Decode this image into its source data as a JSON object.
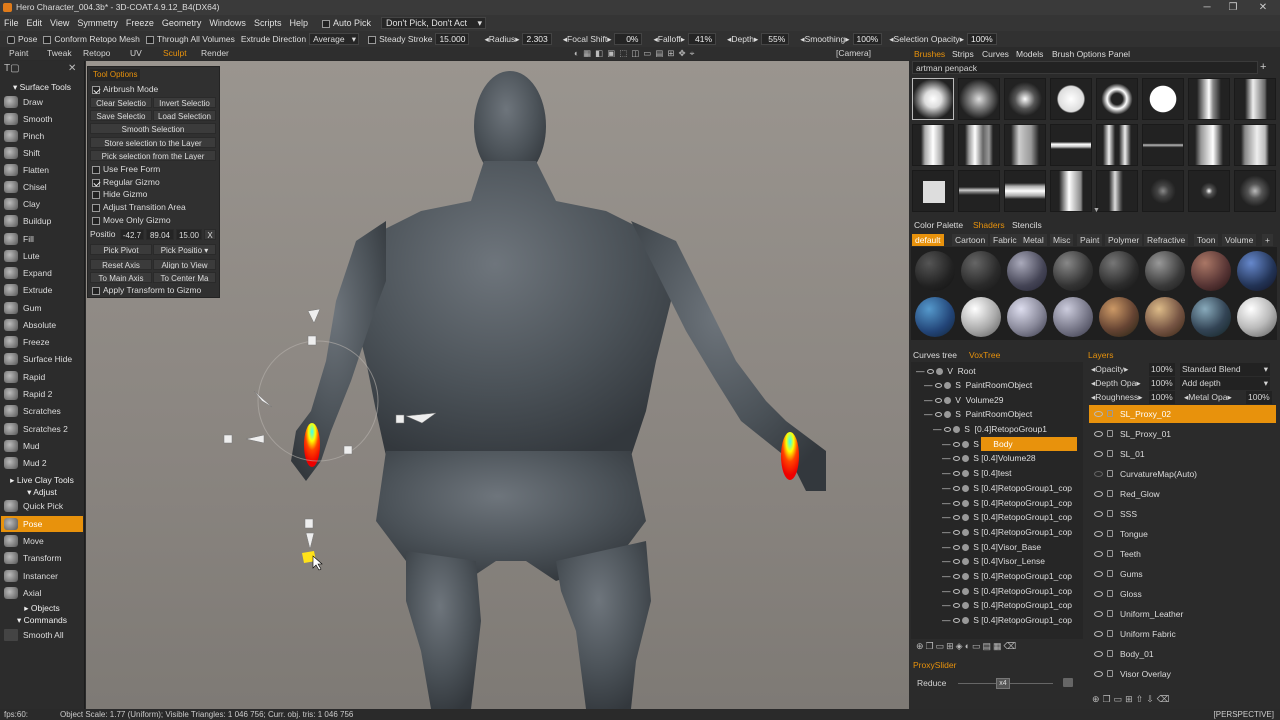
{
  "window": {
    "title": "Hero Character_004.3b* - 3D-COAT.4.9.12_B4(DX64)",
    "minimize": "─",
    "maximize": "❐",
    "close": "✕"
  },
  "menu": [
    "File",
    "Edit",
    "View",
    "Symmetry",
    "Freeze",
    "Geometry",
    "Windows",
    "Scripts",
    "Help"
  ],
  "menu_extra": {
    "auto_pick": "Auto Pick",
    "pick_mode": "Don't Pick, Don't Act"
  },
  "toolbar1": {
    "pose": "Pose",
    "conform": "Conform Retopo Mesh",
    "through": "Through All Volumes",
    "extrude_dir": "Extrude Direction",
    "extrude_val": "Average",
    "steady": "Steady Stroke",
    "steady_val": "15.000",
    "radius": "Radius",
    "radius_val": "2.303",
    "focal": "Focal Shift",
    "focal_val": "0%",
    "falloff": "Falloff",
    "falloff_val": "41%",
    "depth": "Depth",
    "depth_val": "55%",
    "smoothing": "Smoothing",
    "smoothing_val": "100%",
    "sel_opacity": "Selection Opacity",
    "sel_opacity_val": "100%"
  },
  "tabs": [
    "Paint",
    "Tweak",
    "Retopo",
    "UV",
    "Sculpt",
    "Render"
  ],
  "camera": "[Camera]",
  "left_panel": {
    "surface_tools": "Surface Tools",
    "surface": [
      "Draw",
      "Smooth",
      "Pinch",
      "Shift",
      "Flatten",
      "Chisel",
      "Clay",
      "Buildup",
      "Fill",
      "Lute",
      "Expand",
      "Extrude",
      "Gum",
      "Absolute",
      "Freeze",
      "Surface Hide",
      "Rapid",
      "Rapid 2",
      "Scratches",
      "Scratches 2",
      "Mud",
      "Mud 2"
    ],
    "live_clay": "Live Clay Tools",
    "adjust": "Adjust",
    "adjust_tools": [
      "Quick Pick",
      "Pose",
      "Move",
      "Transform",
      "Instancer",
      "Axial"
    ],
    "objects": "Objects",
    "commands": "Commands",
    "smooth_all": "Smooth All"
  },
  "tool_options": {
    "tab": "Tool Options",
    "airbrush": "Airbrush Mode",
    "clear": "Clear Selectio",
    "invert": "Invert Selectio",
    "save": "Save Selectio",
    "load": "Load Selection",
    "smooth_sel": "Smooth Selection",
    "store": "Store selection to the Layer",
    "pick_layer": "Pick selection from the Layer",
    "free_form": "Use Free Form",
    "regular_gizmo": "Regular Gizmo",
    "hide_gizmo": "Hide Gizmo",
    "adjust_transition": "Adjust Transition Area",
    "move_only": "Move Only Gizmo",
    "position_label": "Positio",
    "pos_x": "-42.7",
    "pos_y": "89.04",
    "pos_z": "15.00",
    "pos_clear": "X",
    "pick_pivot": "Pick Pivot",
    "pick_position": "Pick Positio",
    "reset_axis": "Reset Axis",
    "align_view": "Align to View",
    "to_main_axis": "To Main Axis",
    "to_center": "To Center Ma",
    "apply_transform": "Apply Transform to Gizmo"
  },
  "brushes": {
    "tab": "Brushes",
    "others": [
      "Strips",
      "Curves",
      "Models",
      "Brush Options Panel"
    ],
    "pack": "artman penpack"
  },
  "shaders": {
    "tabs": [
      "Color Palette",
      "Shaders",
      "Stencils"
    ],
    "categories": [
      "default",
      "Cartoon",
      "Fabric",
      "Metal",
      "Misc",
      "Paint",
      "Polymer",
      "Refractive",
      "Toon",
      "Volume"
    ]
  },
  "vox_tree": {
    "tabs": [
      "Curves tree",
      "VoxTree"
    ],
    "items": [
      {
        "indent": 0,
        "type": "V",
        "name": "Root"
      },
      {
        "indent": 1,
        "type": "S",
        "name": "PaintRoomObject"
      },
      {
        "indent": 1,
        "type": "V",
        "name": "Volume29"
      },
      {
        "indent": 1,
        "type": "S",
        "name": "PaintRoomObject"
      },
      {
        "indent": 2,
        "type": "S",
        "name": "[0.4]RetopoGroup1"
      },
      {
        "indent": 3,
        "type": "S",
        "name": "Body",
        "selected": true
      },
      {
        "indent": 3,
        "type": "S",
        "name": "[0.4]Volume28"
      },
      {
        "indent": 3,
        "type": "S",
        "name": "[0.4]test"
      },
      {
        "indent": 3,
        "type": "S",
        "name": "[0.4]RetopoGroup1_cop"
      },
      {
        "indent": 3,
        "type": "S",
        "name": "[0.4]RetopoGroup1_cop"
      },
      {
        "indent": 3,
        "type": "S",
        "name": "[0.4]RetopoGroup1_cop"
      },
      {
        "indent": 3,
        "type": "S",
        "name": "[0.4]RetopoGroup1_cop"
      },
      {
        "indent": 3,
        "type": "S",
        "name": "[0.4]Visor_Base"
      },
      {
        "indent": 3,
        "type": "S",
        "name": "[0.4]Visor_Lense"
      },
      {
        "indent": 3,
        "type": "S",
        "name": "[0.4]RetopoGroup1_cop"
      },
      {
        "indent": 3,
        "type": "S",
        "name": "[0.4]RetopoGroup1_cop"
      },
      {
        "indent": 3,
        "type": "S",
        "name": "[0.4]RetopoGroup1_cop"
      },
      {
        "indent": 3,
        "type": "S",
        "name": "[0.4]RetopoGroup1_cop"
      }
    ]
  },
  "layers": {
    "tab": "Layers",
    "opacity": "Opacity",
    "opacity_val": "100%",
    "blend": "Standard Blend",
    "depth_opa": "Depth Opa",
    "depth_opa_val": "100%",
    "add_depth": "Add depth",
    "roughness": "Roughness",
    "roughness_val": "100%",
    "metal_opa": "Metal Opa",
    "metal_opa_val": "100%",
    "items": [
      "SL_Proxy_02",
      "SL_Proxy_01",
      "SL_01",
      "CurvatureMap(Auto)",
      "Red_Glow",
      "SSS",
      "Tongue",
      "Teeth",
      "Gums",
      "Gloss",
      "Uniform_Leather",
      "Uniform Fabric",
      "Body_01",
      "Visor Overlay"
    ],
    "selected": "SL_Proxy_02"
  },
  "proxy": {
    "tab": "ProxySlider",
    "reduce": "Reduce",
    "value": "x4"
  },
  "status": {
    "fps": "fps:60:",
    "info": "Object Scale: 1.77 (Uniform); Visible Triangles: 1 046 756; Curr. obj. tris: 1 046 756",
    "view": "[PERSPECTIVE]"
  },
  "colors": {
    "accent": "#e8920c",
    "panel": "#2c2c2c"
  }
}
